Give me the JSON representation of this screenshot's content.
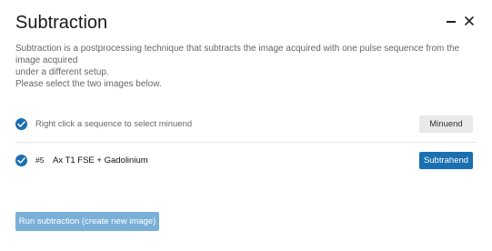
{
  "dialog": {
    "title": "Subtraction",
    "description_lines": [
      "Subtraction is a postprocessing technique that subtracts the image acquired with one pulse sequence from the image acquired",
      "under a different setup.",
      "Please select the two images below."
    ],
    "minimize_icon": "minimize-icon",
    "close_icon": "close-icon"
  },
  "minuend_row": {
    "hint": "Right click a sequence to select minuend",
    "button_label": "Minuend",
    "check_icon": "check-circle-icon"
  },
  "subtrahend_row": {
    "sequence_number": "#5",
    "sequence_name": "Ax T1 FSE + Gadolinium",
    "button_label": "Subtrahend",
    "check_icon": "check-circle-icon"
  },
  "footer": {
    "run_label": "Run subtraction (create new image)"
  },
  "colors": {
    "accent": "#1a6fb0",
    "run_button_disabled": "#7ab0d8",
    "minuend_button_bg": "#e9e9e9"
  }
}
